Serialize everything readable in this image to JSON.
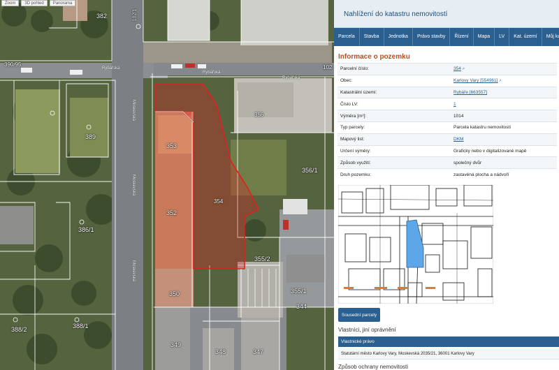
{
  "map": {
    "toolbar": [
      "Zoom",
      "3D pohled",
      "Panorama"
    ],
    "parcel_labels": [
      {
        "id": "382",
        "text": "382"
      },
      {
        "id": "102-left",
        "text": "102/1"
      },
      {
        "id": "390-95",
        "text": "390/95"
      },
      {
        "id": "389",
        "text": "389"
      },
      {
        "id": "353",
        "text": "353"
      },
      {
        "id": "352",
        "text": "352"
      },
      {
        "id": "354",
        "text": "354"
      },
      {
        "id": "356-1",
        "text": "356/1"
      },
      {
        "id": "355-1",
        "text": "355/1"
      },
      {
        "id": "355-2",
        "text": "355/2"
      },
      {
        "id": "386-1",
        "text": "386/1"
      },
      {
        "id": "350",
        "text": "350"
      },
      {
        "id": "344",
        "text": "344"
      },
      {
        "id": "388-2",
        "text": "388/2"
      },
      {
        "id": "388-1",
        "text": "388/1"
      },
      {
        "id": "349",
        "text": "349"
      },
      {
        "id": "348",
        "text": "348"
      },
      {
        "id": "347",
        "text": "347"
      },
      {
        "id": "102-right",
        "text": "102"
      },
      {
        "id": "356-pl",
        "text": "356"
      }
    ],
    "street_labels": [
      {
        "id": "s1",
        "text": "Rybářská"
      },
      {
        "id": "s2",
        "text": "Rybářská"
      },
      {
        "id": "s3",
        "text": "Rybářská"
      },
      {
        "id": "s4",
        "text": "Moskevská"
      },
      {
        "id": "s5",
        "text": "Moskevská"
      },
      {
        "id": "s6",
        "text": "Moskevská"
      }
    ],
    "colors": {
      "highlight": "#e02020",
      "parcel_lines": "#ffffff"
    }
  },
  "panel": {
    "title": "Nahlížení do katastru nemovitostí",
    "tabs": [
      "Parcela",
      "Stavba",
      "Jednotka",
      "Právo stavby",
      "Řízení",
      "Mapa",
      "LV",
      "Kat. území",
      "Můj ka"
    ],
    "section_title": "Informace o pozemku",
    "rows": [
      {
        "key": "Parcelní číslo:",
        "value": "354",
        "link": true,
        "ext": true
      },
      {
        "key": "Obec:",
        "value": "Karlovy Vary [554961]",
        "link": true,
        "ext": true
      },
      {
        "key": "Katastrální území:",
        "value": "Rybáře [663557]",
        "link": true,
        "ext": false
      },
      {
        "key": "Číslo LV:",
        "value": "1",
        "link": true,
        "ext": false
      },
      {
        "key": "Výměra [m²]:",
        "value": "1014",
        "link": false,
        "ext": false
      },
      {
        "key": "Typ parcely:",
        "value": "Parcela katastru nemovitostí",
        "link": false,
        "ext": false
      },
      {
        "key": "Mapový list:",
        "value": "DKM",
        "link": true,
        "ext": false
      },
      {
        "key": "Určení výměry:",
        "value": "Graficky nebo v digitalizované mapě",
        "link": false,
        "ext": false
      },
      {
        "key": "Způsob využití:",
        "value": "společný dvůr",
        "link": false,
        "ext": false
      },
      {
        "key": "Druh pozemku:",
        "value": "zastavěná plocha a nádvoří",
        "link": false,
        "ext": false
      }
    ],
    "neighbors_button": "Sousední parcely",
    "owners_title": "Vlastníci, jiní oprávnění",
    "owners_header": "Vlastnické právo",
    "owner": "Statutární město Karlovy Vary, Moskevská 2035/21, 36001 Karlovy Vary",
    "protection_title": "Způsob ochrany nemovitosti",
    "thumb_colors": {
      "highlight": "#5da6e8",
      "lines": "#111111",
      "marker": "#e07a2e"
    }
  }
}
